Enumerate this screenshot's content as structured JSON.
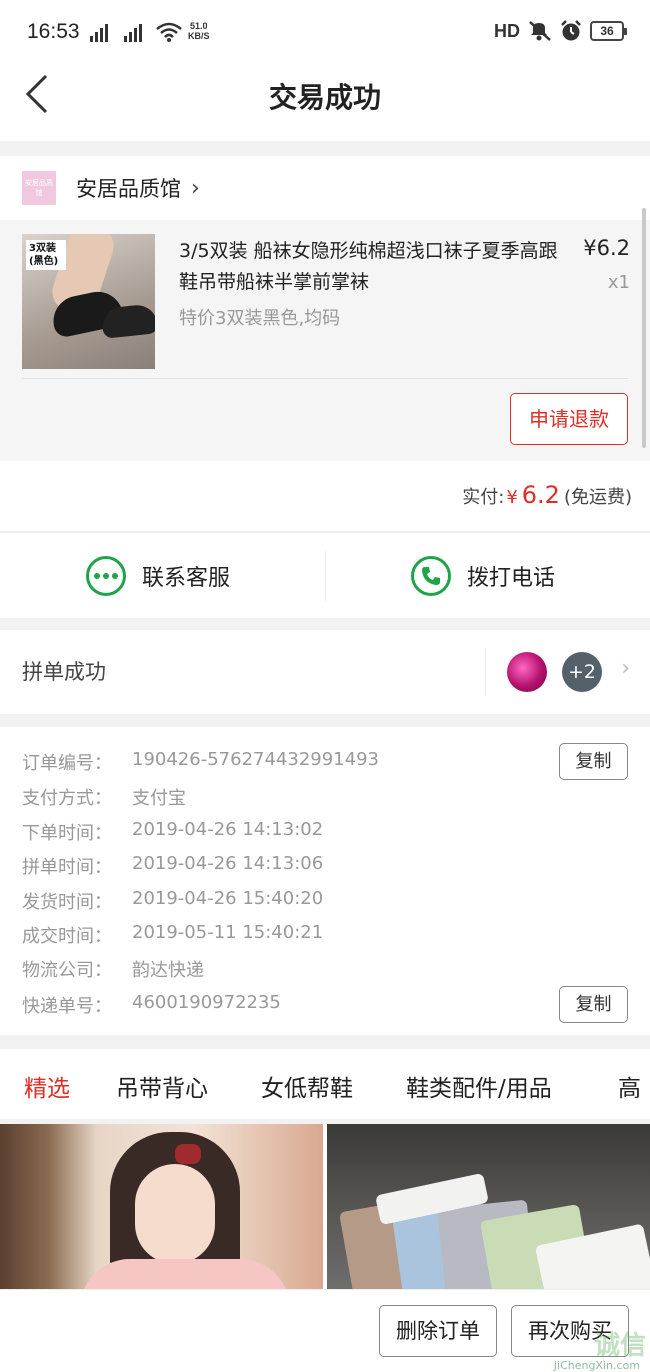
{
  "status_bar": {
    "time": "16:53",
    "net_speed_value": "51.0",
    "net_speed_unit": "KB/S",
    "hd_label": "HD",
    "battery": "36"
  },
  "header": {
    "title": "交易成功"
  },
  "store": {
    "logo_text": "安居品质馆",
    "name": "安居品质馆",
    "item": {
      "thumb_tag": "3双装 (黑色)",
      "title": "3/5双装 船袜女隐形纯棉超浅口袜子夏季高跟鞋吊带船袜半掌前掌袜",
      "spec": "特价3双装黑色,均码",
      "price": "¥6.2",
      "qty": "x1"
    },
    "refund_label": "申请退款"
  },
  "payment": {
    "label": "实付:",
    "currency": "¥",
    "amount": "6.2",
    "shipping_note": "(免运费)"
  },
  "contact": {
    "service_label": "联系客服",
    "call_label": "拨打电话",
    "service_icon": "chat-bubble-icon",
    "call_icon": "phone-icon"
  },
  "group": {
    "label": "拼单成功",
    "more_count": "+2"
  },
  "order_info": {
    "rows": [
      {
        "key": "订单编号：",
        "value": "190426-576274432991493"
      },
      {
        "key": "支付方式：",
        "value": "支付宝"
      },
      {
        "key": "下单时间：",
        "value": "2019-04-26 14:13:02"
      },
      {
        "key": "拼单时间：",
        "value": "2019-04-26 14:13:06"
      },
      {
        "key": "发货时间：",
        "value": "2019-04-26 15:40:20"
      },
      {
        "key": "成交时间：",
        "value": "2019-05-11 15:40:21"
      },
      {
        "key": "物流公司：",
        "value": "韵达快递"
      },
      {
        "key": "快递单号：",
        "value": "4600190972235"
      }
    ],
    "copy_label": "复制"
  },
  "category_tabs": [
    "精选",
    "吊带背心",
    "女低帮鞋",
    "鞋类配件/用品",
    "高"
  ],
  "bottom_bar": {
    "delete_label": "删除订单",
    "rebuy_label": "再次购买"
  },
  "watermark": {
    "text": "诚信",
    "url_text": "JiChengXin.com"
  },
  "colors": {
    "accent_red": "#e02e24",
    "green": "#1fa44a"
  }
}
